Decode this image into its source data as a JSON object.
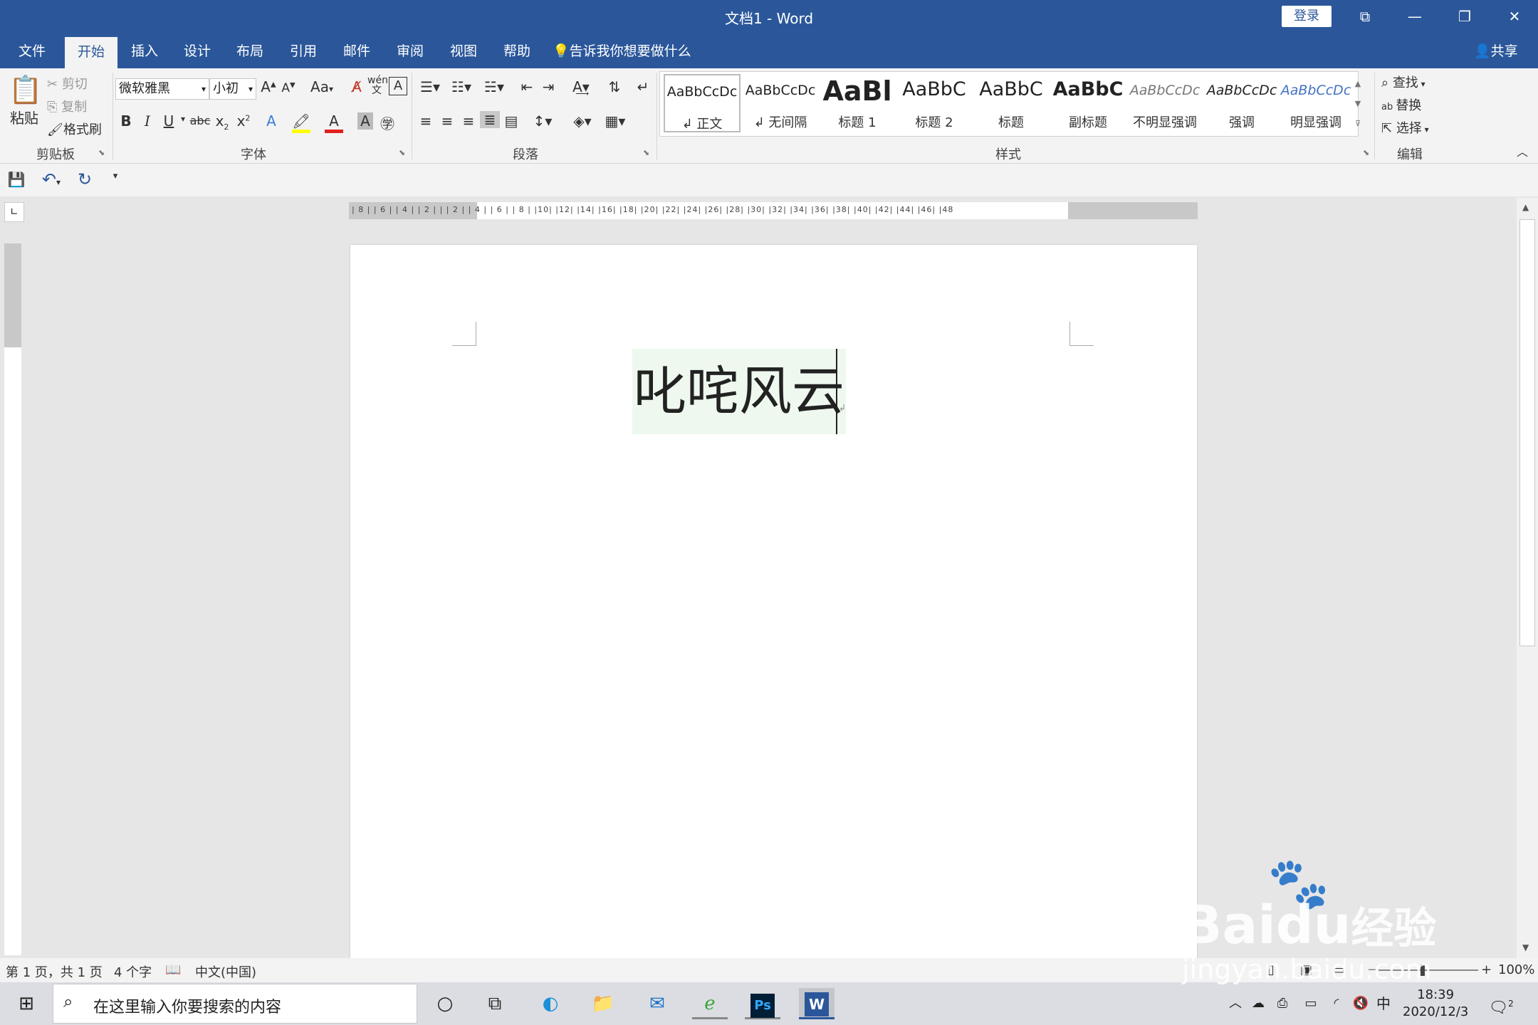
{
  "window": {
    "title": "文档1  -  Word",
    "login": "登录"
  },
  "tabs": [
    "文件",
    "开始",
    "插入",
    "设计",
    "布局",
    "引用",
    "邮件",
    "审阅",
    "视图",
    "帮助"
  ],
  "tellme": "告诉我你想要做什么",
  "share": "共享",
  "clipboard": {
    "paste": "粘贴",
    "cut": "剪切",
    "copy": "复制",
    "format_painter": "格式刷",
    "label": "剪贴板"
  },
  "font": {
    "name": "微软雅黑",
    "size": "小初",
    "label": "字体",
    "change_case": "Aa"
  },
  "paragraph": {
    "label": "段落"
  },
  "styles": {
    "label": "样式",
    "items": [
      {
        "sample": "AaBbCcDc",
        "name": "↲ 正文"
      },
      {
        "sample": "AaBbCcDc",
        "name": "↲ 无间隔"
      },
      {
        "sample": "AaBl",
        "name": "标题 1"
      },
      {
        "sample": "AaBbC",
        "name": "标题 2"
      },
      {
        "sample": "AaBbC",
        "name": "标题"
      },
      {
        "sample": "AaBbC",
        "name": "副标题"
      },
      {
        "sample": "AaBbCcDc",
        "name": "不明显强调"
      },
      {
        "sample": "AaBbCcDc",
        "name": "强调"
      },
      {
        "sample": "AaBbCcDc",
        "name": "明显强调"
      }
    ]
  },
  "editing": {
    "find": "查找",
    "replace": "替换",
    "select": "选择",
    "label": "编辑"
  },
  "ruler": {
    "numbers": "| 8 |   | 6 |   | 4 |   | 2 |   |       | 2 |   | 4 |   | 6 |   | 8 |   |10|   |12|   |14|   |16|   |18|   |20|   |22|   |24|   |26|   |28|   |30|   |32|   |34|   |36|   |38|   |40|   |42|   |44|   |46|   |48"
  },
  "document": {
    "text": "叱咤风云"
  },
  "status": {
    "page": "第 1 页，共 1 页",
    "words": "4 个字",
    "language": "中文(中国)",
    "zoom": "100%"
  },
  "taskbar": {
    "search_placeholder": "在这里输入你要搜索的内容",
    "time": "18:39",
    "date": "2020/12/3",
    "ime": "中",
    "notifications": "2"
  },
  "watermark": {
    "brand": "Bai",
    "brand2": "du",
    "site_cn": "经验",
    "url": "jingyan.baidu.com"
  }
}
